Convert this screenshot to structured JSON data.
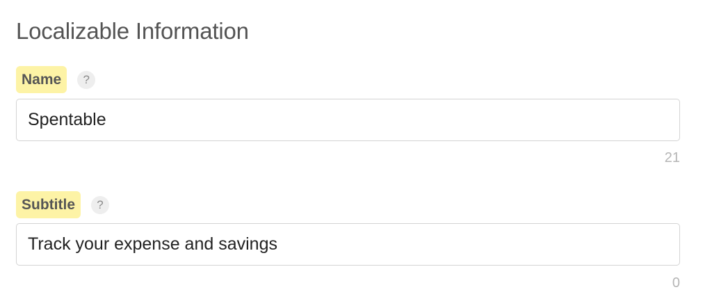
{
  "section": {
    "title": "Localizable Information"
  },
  "fields": {
    "name": {
      "label": "Name",
      "help_glyph": "?",
      "help_icon": "question-mark-icon",
      "value": "Spentable",
      "char_count": "21"
    },
    "subtitle": {
      "label": "Subtitle",
      "help_glyph": "?",
      "help_icon": "question-mark-icon",
      "value": "Track your expense and savings",
      "char_count": "0"
    }
  },
  "colors": {
    "label_highlight": "#fdf3a6",
    "input_border": "#d3d3d3",
    "count_text": "#b5b5b5"
  }
}
